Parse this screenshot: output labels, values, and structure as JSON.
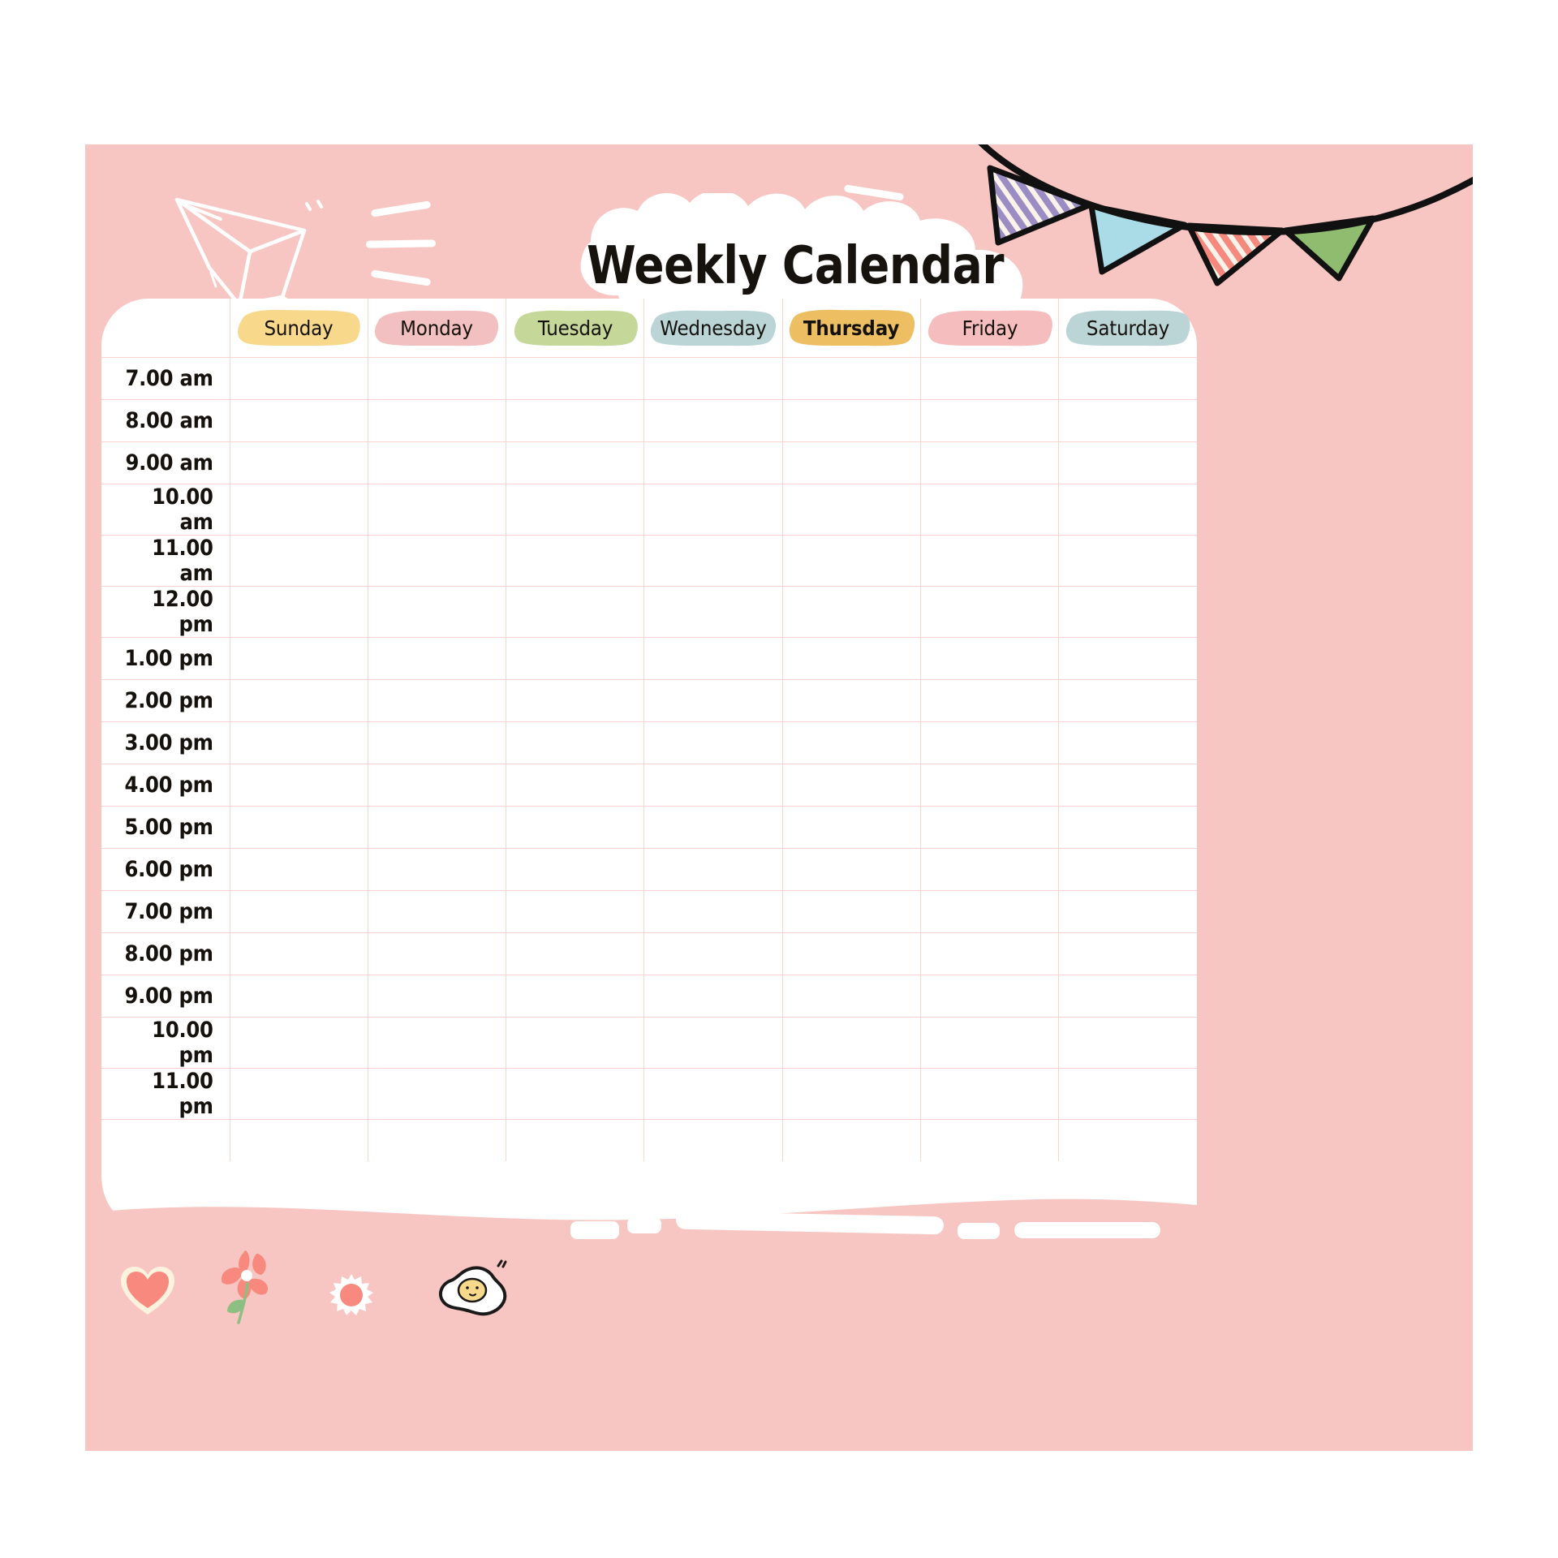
{
  "page": {
    "title": "Weekly Calendar",
    "background_color": "#FFFFFF",
    "poster_color": "#F8C6C2",
    "card_color": "#FFFFFF",
    "grid_line_color": "#FBD4D1",
    "text_color": "#15120E"
  },
  "header": {
    "title": "Weekly Calendar",
    "decorations": [
      {
        "name": "paper-plane-doodle",
        "color": "#FFFFFF"
      },
      {
        "name": "speed-lines-doodle",
        "color": "#FFFFFF"
      },
      {
        "name": "title-cloud-shape",
        "color": "#FFFFFF"
      },
      {
        "name": "bunting-flags-doodle"
      }
    ]
  },
  "bunting": {
    "flags": [
      {
        "name": "flag-purple-striped",
        "color": "#9B8CC4",
        "pattern": "striped"
      },
      {
        "name": "flag-blue",
        "color": "#A9DCE6",
        "pattern": "solid"
      },
      {
        "name": "flag-coral-striped",
        "color": "#F5897E",
        "pattern": "striped"
      },
      {
        "name": "flag-green",
        "color": "#8FBC6E",
        "pattern": "solid"
      }
    ],
    "string_color": "#111111"
  },
  "calendar": {
    "time_column_header": "",
    "days": [
      {
        "label": "Sunday",
        "color": "#F8D98B",
        "bold": false
      },
      {
        "label": "Monday",
        "color": "#F2C0C0",
        "bold": false
      },
      {
        "label": "Tuesday",
        "color": "#C5D89A",
        "bold": false
      },
      {
        "label": "Wednesday",
        "color": "#BBD5D7",
        "bold": false
      },
      {
        "label": "Thursday",
        "color": "#EDBE62",
        "bold": true
      },
      {
        "label": "Friday",
        "color": "#F5BDBD",
        "bold": false
      },
      {
        "label": "Saturday",
        "color": "#BBD5D7",
        "bold": false
      }
    ],
    "times": [
      "7.00 am",
      "8.00 am",
      "9.00 am",
      "10.00 am",
      "11.00 am",
      "12.00 pm",
      "1.00 pm",
      "2.00 pm",
      "3.00 pm",
      "4.00 pm",
      "5.00 pm",
      "6.00 pm",
      "7.00 pm",
      "8.00 pm",
      "9.00 pm",
      "10.00 pm",
      "11.00 pm",
      ""
    ],
    "entries": []
  },
  "footer": {
    "doodles": [
      {
        "name": "heart-doodle",
        "color": "#F7897E",
        "outline": "#FBF3DE"
      },
      {
        "name": "flower-doodle",
        "color": "#F7897E",
        "stem_color": "#8DBE82"
      },
      {
        "name": "daisy-doodle",
        "color": "#F7897E",
        "outline": "#FFFFFF"
      },
      {
        "name": "fried-egg-doodle",
        "white": "#FFFFFF",
        "yolk": "#F6D98B",
        "outline": "#1A1A1A"
      }
    ]
  }
}
